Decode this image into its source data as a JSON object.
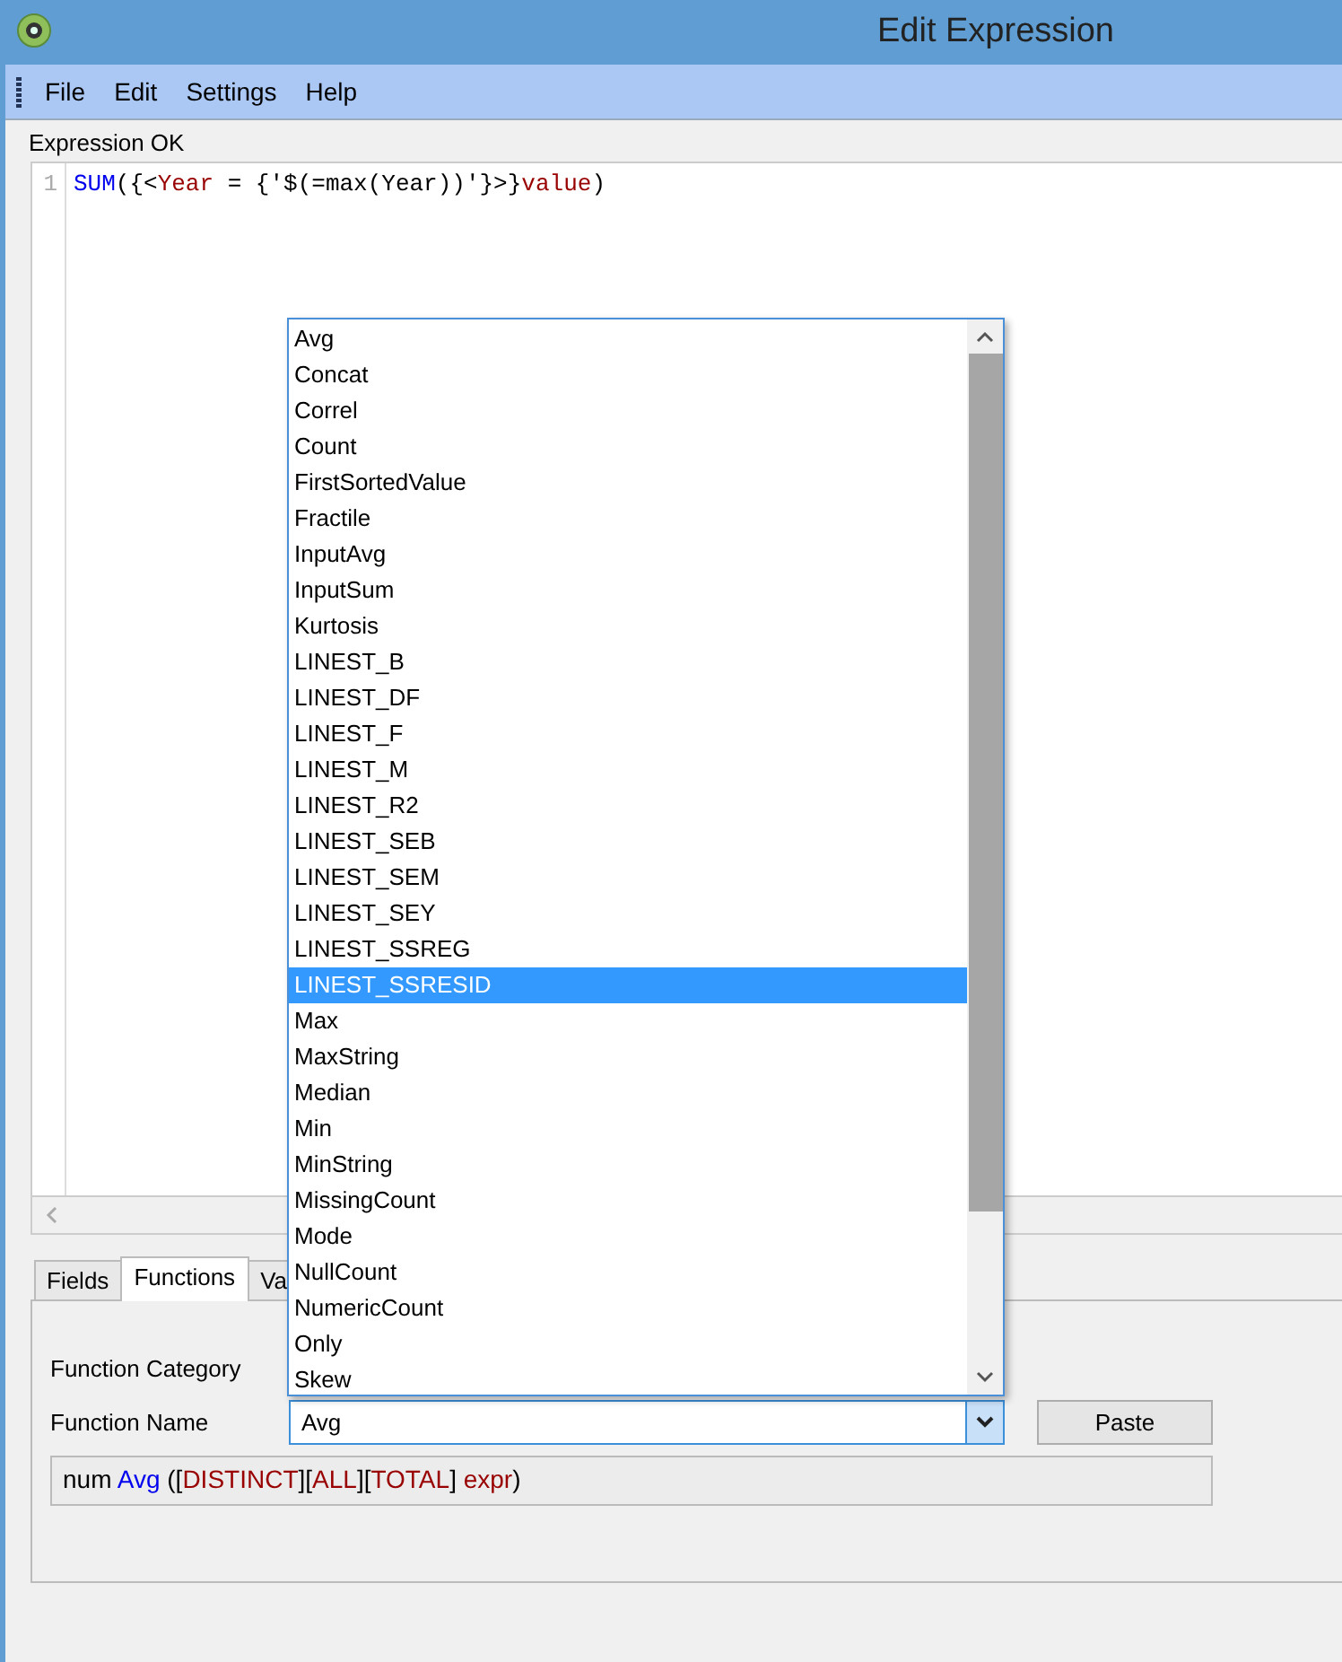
{
  "window": {
    "title": "Edit Expression"
  },
  "menu": [
    "File",
    "Edit",
    "Settings",
    "Help"
  ],
  "status": "Expression OK",
  "editor": {
    "line_number": "1",
    "tokens": [
      {
        "text": "SUM",
        "kind": "function"
      },
      {
        "text": "({<",
        "kind": "plain"
      },
      {
        "text": "Year",
        "kind": "field"
      },
      {
        "text": " = {'$(=max(Year))'}>}",
        "kind": "plain"
      },
      {
        "text": "value",
        "kind": "field"
      },
      {
        "text": ")",
        "kind": "plain"
      }
    ]
  },
  "tabs": [
    {
      "label": "Fields",
      "selected": false
    },
    {
      "label": "Functions",
      "selected": true
    },
    {
      "label": "Va",
      "selected": false
    }
  ],
  "function_category": {
    "label": "Function Category"
  },
  "function_name": {
    "label": "Function Name",
    "value": "Avg",
    "expanded": true
  },
  "paste_button": "Paste",
  "syntax": [
    {
      "text": "num ",
      "kind": "plain"
    },
    {
      "text": "Avg",
      "kind": "function"
    },
    {
      "text": " ([",
      "kind": "plain"
    },
    {
      "text": "DISTINCT",
      "kind": "field"
    },
    {
      "text": "][",
      "kind": "plain"
    },
    {
      "text": "ALL",
      "kind": "field"
    },
    {
      "text": "][",
      "kind": "plain"
    },
    {
      "text": "TOTAL",
      "kind": "field"
    },
    {
      "text": "] ",
      "kind": "plain"
    },
    {
      "text": "expr",
      "kind": "field"
    },
    {
      "text": ")",
      "kind": "plain"
    }
  ],
  "dropdown_items": [
    {
      "label": "Avg",
      "selected": false
    },
    {
      "label": "Concat",
      "selected": false
    },
    {
      "label": "Correl",
      "selected": false
    },
    {
      "label": "Count",
      "selected": false
    },
    {
      "label": "FirstSortedValue",
      "selected": false
    },
    {
      "label": "Fractile",
      "selected": false
    },
    {
      "label": "InputAvg",
      "selected": false
    },
    {
      "label": "InputSum",
      "selected": false
    },
    {
      "label": "Kurtosis",
      "selected": false
    },
    {
      "label": "LINEST_B",
      "selected": false
    },
    {
      "label": "LINEST_DF",
      "selected": false
    },
    {
      "label": "LINEST_F",
      "selected": false
    },
    {
      "label": "LINEST_M",
      "selected": false
    },
    {
      "label": "LINEST_R2",
      "selected": false
    },
    {
      "label": "LINEST_SEB",
      "selected": false
    },
    {
      "label": "LINEST_SEM",
      "selected": false
    },
    {
      "label": "LINEST_SEY",
      "selected": false
    },
    {
      "label": "LINEST_SSREG",
      "selected": false
    },
    {
      "label": "LINEST_SSRESID",
      "selected": true
    },
    {
      "label": "Max",
      "selected": false
    },
    {
      "label": "MaxString",
      "selected": false
    },
    {
      "label": "Median",
      "selected": false
    },
    {
      "label": "Min",
      "selected": false
    },
    {
      "label": "MinString",
      "selected": false
    },
    {
      "label": "MissingCount",
      "selected": false
    },
    {
      "label": "Mode",
      "selected": false
    },
    {
      "label": "NullCount",
      "selected": false
    },
    {
      "label": "NumericCount",
      "selected": false
    },
    {
      "label": "Only",
      "selected": false
    },
    {
      "label": "Skew",
      "selected": false
    }
  ]
}
